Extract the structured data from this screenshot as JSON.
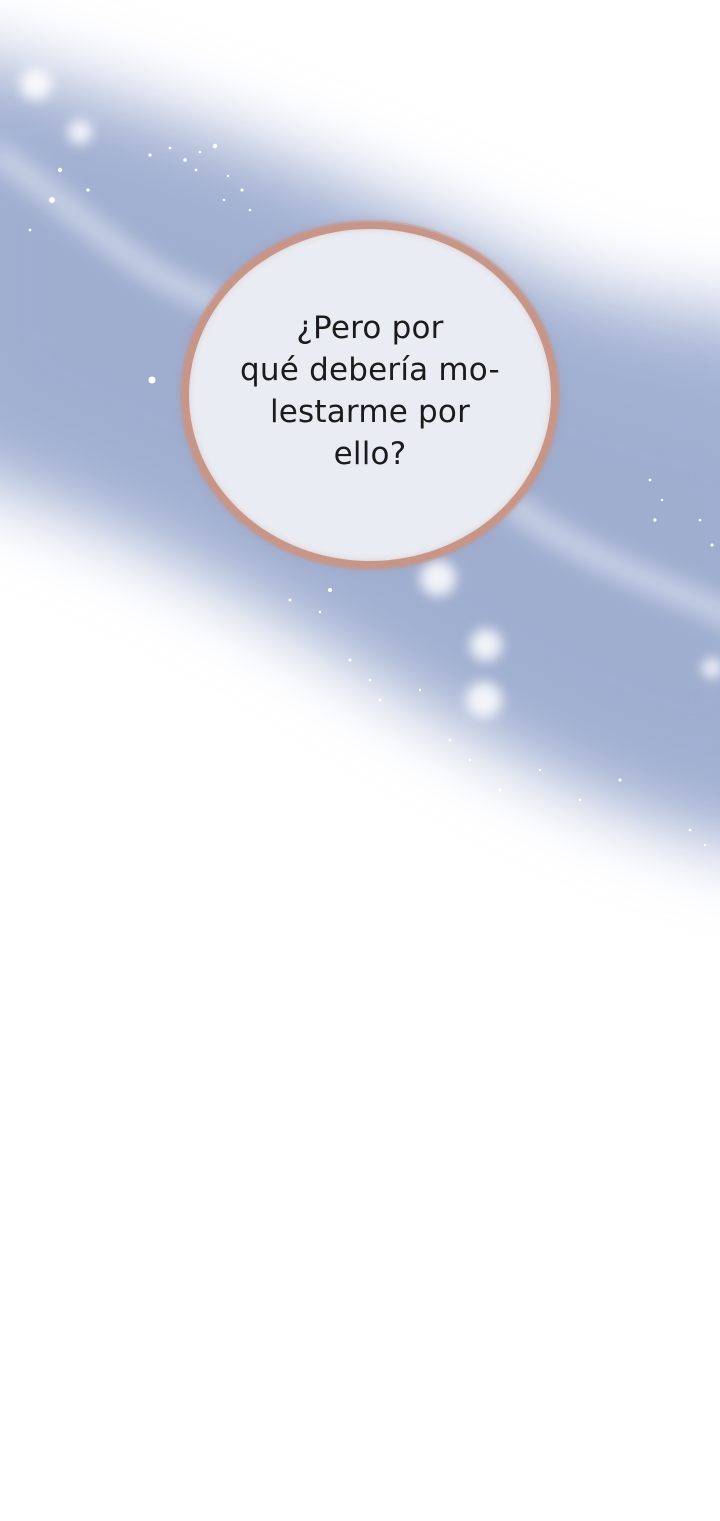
{
  "speech_bubble": {
    "lines": [
      "¿Pero por",
      "qué debería mo-",
      "lestarme por",
      "ello?"
    ]
  },
  "colors": {
    "band": "#a9b6d6",
    "band_light": "#c8d2e6",
    "bubble_fill": "#e9ecf2",
    "bubble_border": "#c89688",
    "background": "#ffffff",
    "text": "#1b1b1b"
  }
}
